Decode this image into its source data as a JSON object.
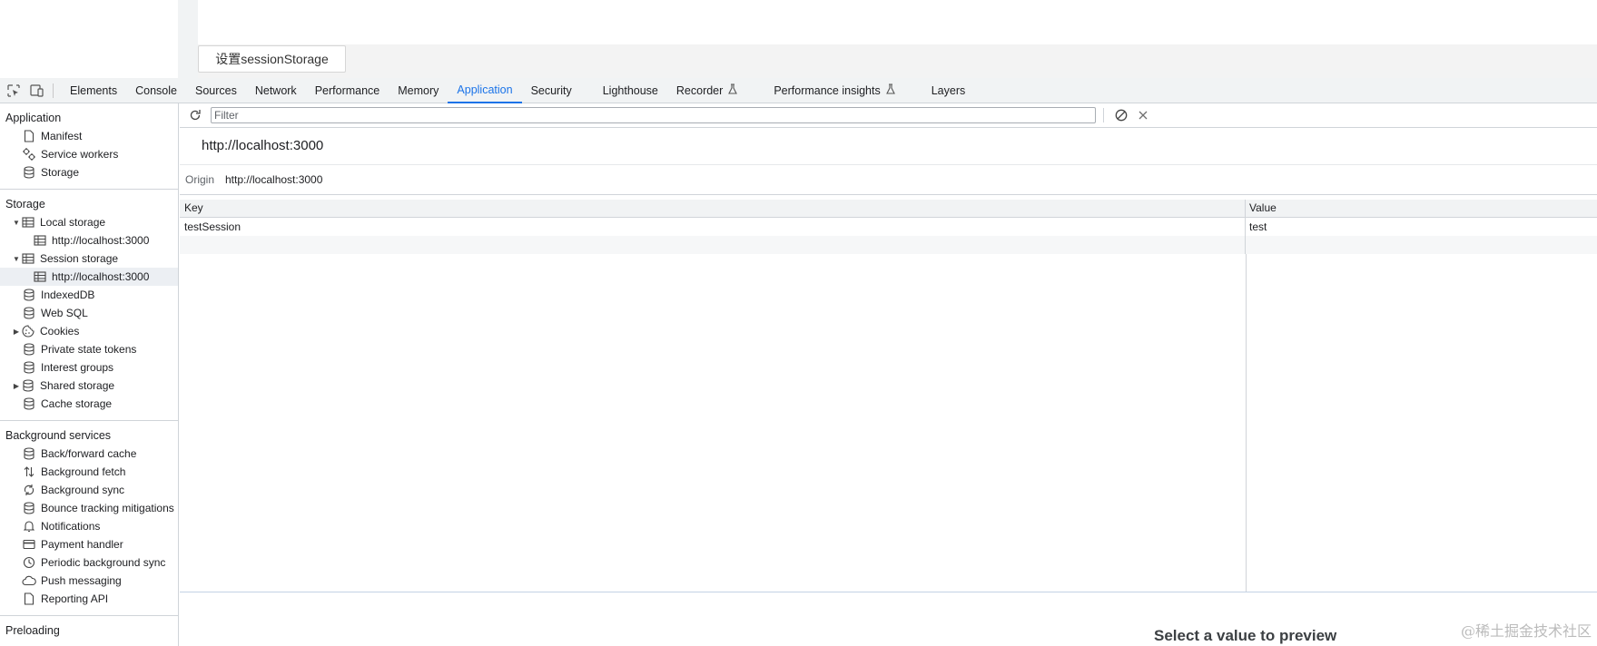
{
  "page": {
    "button_label": "设置sessionStorage"
  },
  "devtools_tabs": [
    {
      "label": "Elements"
    },
    {
      "label": "Console"
    },
    {
      "label": "Sources"
    },
    {
      "label": "Network"
    },
    {
      "label": "Performance"
    },
    {
      "label": "Memory"
    },
    {
      "label": "Application",
      "active": true
    },
    {
      "label": "Security"
    },
    {
      "label": "Lighthouse"
    },
    {
      "label": "Recorder",
      "flask": true
    },
    {
      "label": "Performance insights",
      "flask": true
    },
    {
      "label": "Layers"
    }
  ],
  "sidebar": {
    "application": {
      "title": "Application",
      "items": [
        {
          "label": "Manifest",
          "icon": "file-icon"
        },
        {
          "label": "Service workers",
          "icon": "gears-icon"
        },
        {
          "label": "Storage",
          "icon": "database-icon"
        }
      ]
    },
    "storage": {
      "title": "Storage",
      "local_storage": "Local storage",
      "local_origin": "http://localhost:3000",
      "session_storage": "Session storage",
      "session_origin": "http://localhost:3000",
      "items": [
        {
          "label": "IndexedDB"
        },
        {
          "label": "Web SQL"
        },
        {
          "label": "Cookies"
        },
        {
          "label": "Private state tokens"
        },
        {
          "label": "Interest groups"
        },
        {
          "label": "Shared storage"
        },
        {
          "label": "Cache storage"
        }
      ]
    },
    "background": {
      "title": "Background services",
      "items": [
        {
          "label": "Back/forward cache"
        },
        {
          "label": "Background fetch"
        },
        {
          "label": "Background sync"
        },
        {
          "label": "Bounce tracking mitigations"
        },
        {
          "label": "Notifications"
        },
        {
          "label": "Payment handler"
        },
        {
          "label": "Periodic background sync"
        },
        {
          "label": "Push messaging"
        },
        {
          "label": "Reporting API"
        }
      ]
    },
    "preloading_title": "Preloading"
  },
  "main": {
    "filter_placeholder": "Filter",
    "origin_title": "http://localhost:3000",
    "origin_label": "Origin",
    "origin_value": "http://localhost:3000",
    "columns": {
      "key": "Key",
      "value": "Value"
    },
    "rows": [
      {
        "key": "testSession",
        "value": "test"
      }
    ],
    "preview_text": "Select a value to preview"
  },
  "watermark": "@稀土掘金技术社区",
  "colors": {
    "accent": "#1a73e8",
    "selected_bg": "#eceff3"
  }
}
